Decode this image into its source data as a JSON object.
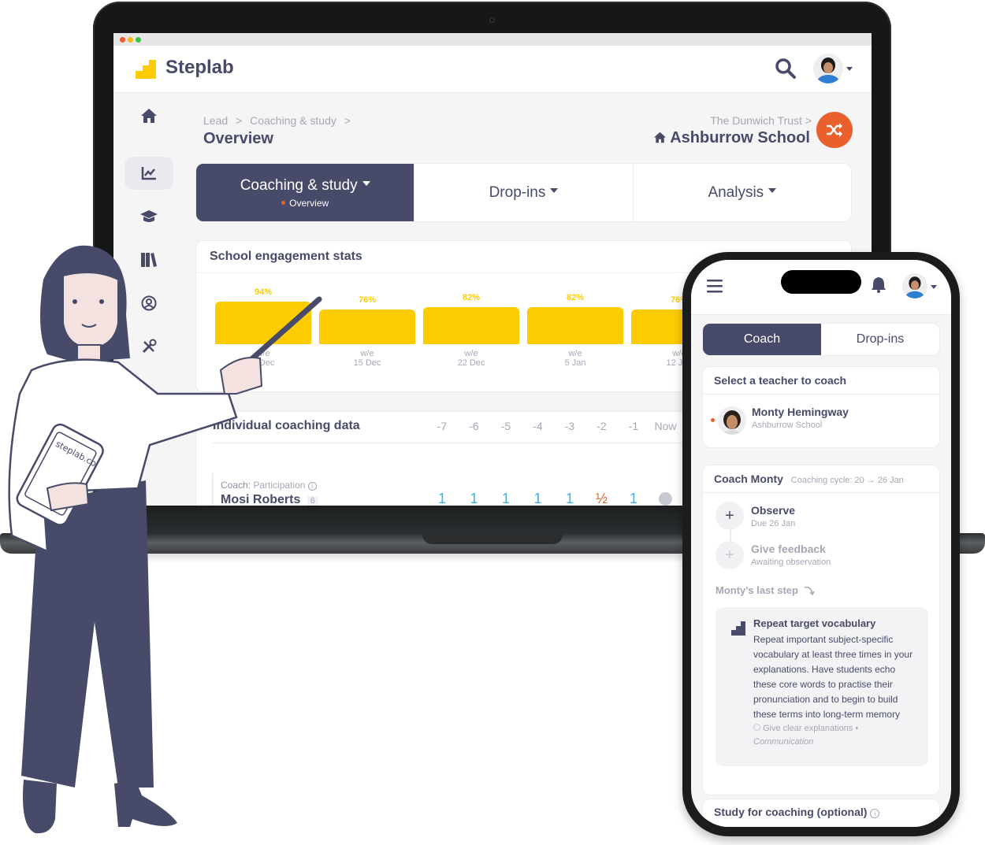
{
  "laptop": {
    "app": {
      "brand": "Steplab",
      "colors": {
        "navy": "#474b69",
        "yellow": "#fccb00",
        "orange": "#e9602d",
        "blue": "#3fb0e8",
        "muted": "#a5a7b5"
      },
      "header_icons": [
        "search-icon",
        "avatar",
        "chevron-down-icon"
      ]
    },
    "sidebar": {
      "items": [
        {
          "icon": "home-icon",
          "active": false
        },
        {
          "icon": "chart-line-icon",
          "active": true
        },
        {
          "icon": "graduation-cap-icon",
          "active": false
        },
        {
          "icon": "books-icon",
          "active": false
        },
        {
          "icon": "user-circle-icon",
          "active": false
        },
        {
          "icon": "tools-icon",
          "active": false
        }
      ]
    },
    "breadcrumb": {
      "items": [
        "Lead",
        "Coaching & study"
      ],
      "separator": ">"
    },
    "page_title": "Overview",
    "org": {
      "trust": "The Dunwich Trust",
      "trust_separator": ">",
      "school": "Ashburrow School",
      "switch_icon": "shuffle-icon"
    },
    "tabs": [
      {
        "label": "Coaching & study",
        "sub": "Overview",
        "active": true
      },
      {
        "label": "Drop-ins",
        "active": false
      },
      {
        "label": "Analysis",
        "active": false
      }
    ],
    "engagement": {
      "title": "School engagement stats"
    },
    "coaching_data": {
      "title": "Individual coaching data",
      "columns": [
        "-7",
        "-6",
        "-5",
        "-4",
        "-3",
        "-2",
        "-1",
        "Now"
      ],
      "rows": [
        {
          "meta_label": "Coach:",
          "meta_value": "Participation",
          "name": "Mosi Roberts",
          "count": "6",
          "values": [
            "1",
            "1",
            "1",
            "1",
            "1",
            "½",
            "1",
            "clock-icon"
          ]
        }
      ]
    }
  },
  "chart_data": {
    "type": "bar",
    "title": "School engagement stats",
    "categories": [
      "w/e 8 Dec",
      "w/e 15 Dec",
      "w/e 22 Dec",
      "w/e 5 Jan",
      "w/e 12 Jan"
    ],
    "category_lines": [
      [
        "w/e",
        "8 Dec"
      ],
      [
        "w/e",
        "15 Dec"
      ],
      [
        "w/e",
        "22 Dec"
      ],
      [
        "w/e",
        "5 Jan"
      ],
      [
        "w/e",
        "12 Jan"
      ]
    ],
    "values": [
      94,
      76,
      82,
      82,
      76
    ],
    "value_labels": [
      "94%",
      "76%",
      "82%",
      "82%",
      "76%"
    ],
    "ylim": [
      0,
      100
    ],
    "xlabel": "",
    "ylabel": "",
    "grid": false,
    "color": "#fccb00"
  },
  "phone": {
    "header_icons": [
      "menu-icon",
      "bell-icon",
      "avatar",
      "chevron-down-icon"
    ],
    "tabs": [
      {
        "label": "Coach",
        "active": true
      },
      {
        "label": "Drop-ins",
        "active": false
      }
    ],
    "select_teacher": {
      "title": "Select a teacher to coach",
      "teacher": {
        "name": "Monty Hemingway",
        "school": "Ashburrow School"
      }
    },
    "coach": {
      "title": "Coach Monty",
      "cycle": "Coaching cycle: 20 → 26 Jan",
      "steps": [
        {
          "label": "Observe",
          "sub": "Due 26 Jan",
          "enabled": true
        },
        {
          "label": "Give feedback",
          "sub": "Awaiting observation",
          "enabled": false
        }
      ],
      "last_step_label": "Monty's last step",
      "last_step": {
        "title": "Repeat target vocabulary",
        "body": "Repeat important subject-specific vocabulary at least three times in your explanations. Have students echo these core words to practise their pronunciation and to begin to build these terms into long-term memory",
        "tag": "Give clear explanations •",
        "category": "Communication"
      }
    },
    "study": {
      "title": "Study for coaching (optional)"
    }
  },
  "illustration": {
    "tablet_text": "steplab.co"
  }
}
